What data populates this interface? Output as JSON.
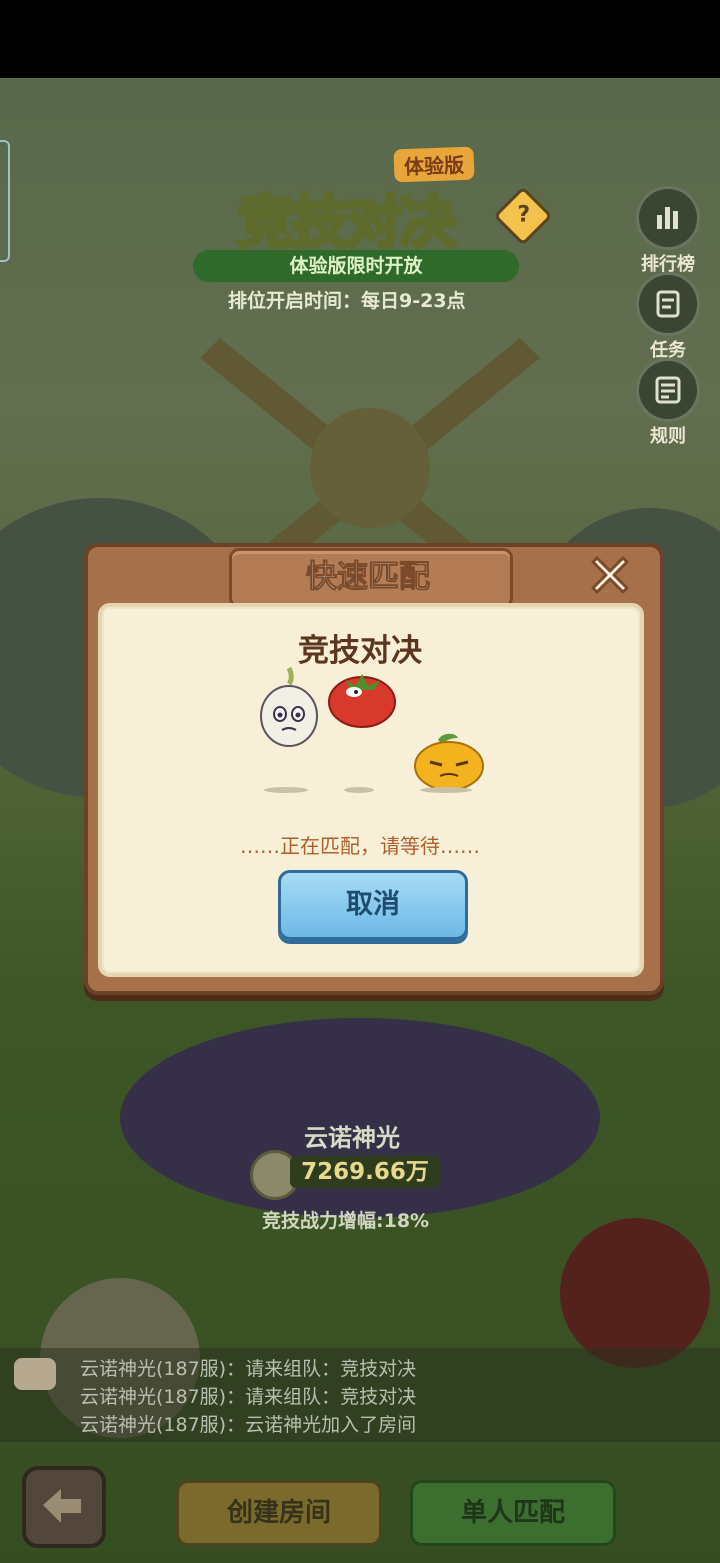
{
  "lobby": {
    "trial_tag": "体验版",
    "title": "竞技对决",
    "help_symbol": "?",
    "open_notice": "体验版限时开放",
    "open_time": "排位开启时间：每日9-23点",
    "side_buttons": [
      {
        "label": "排行榜",
        "icon": "leaderboard-icon"
      },
      {
        "label": "任务",
        "icon": "task-icon"
      },
      {
        "label": "规则",
        "icon": "rules-icon"
      }
    ],
    "hero_name": "云诺神光",
    "power": "7269.66万",
    "boost": "竞技战力增幅:18%"
  },
  "chat": {
    "lines": [
      "云诺神光(187服)：请来组队：竞技对决",
      "云诺神光(187服)：请来组队：竞技对决",
      "云诺神光(187服)：云诺神光加入了房间"
    ]
  },
  "bottom": {
    "create_room": "创建房间",
    "solo_match": "单人匹配"
  },
  "modal": {
    "title": "快速匹配",
    "subtitle": "竞技对决",
    "status": "……正在匹配，请等待……",
    "cancel": "取消",
    "characters": [
      "garlic",
      "tomato",
      "orange"
    ]
  },
  "colors": {
    "modal_frame": "#a5704a",
    "modal_paper": "#f7efd7",
    "cancel_button": "#6cb8e6",
    "status_text": "#b0602e"
  }
}
